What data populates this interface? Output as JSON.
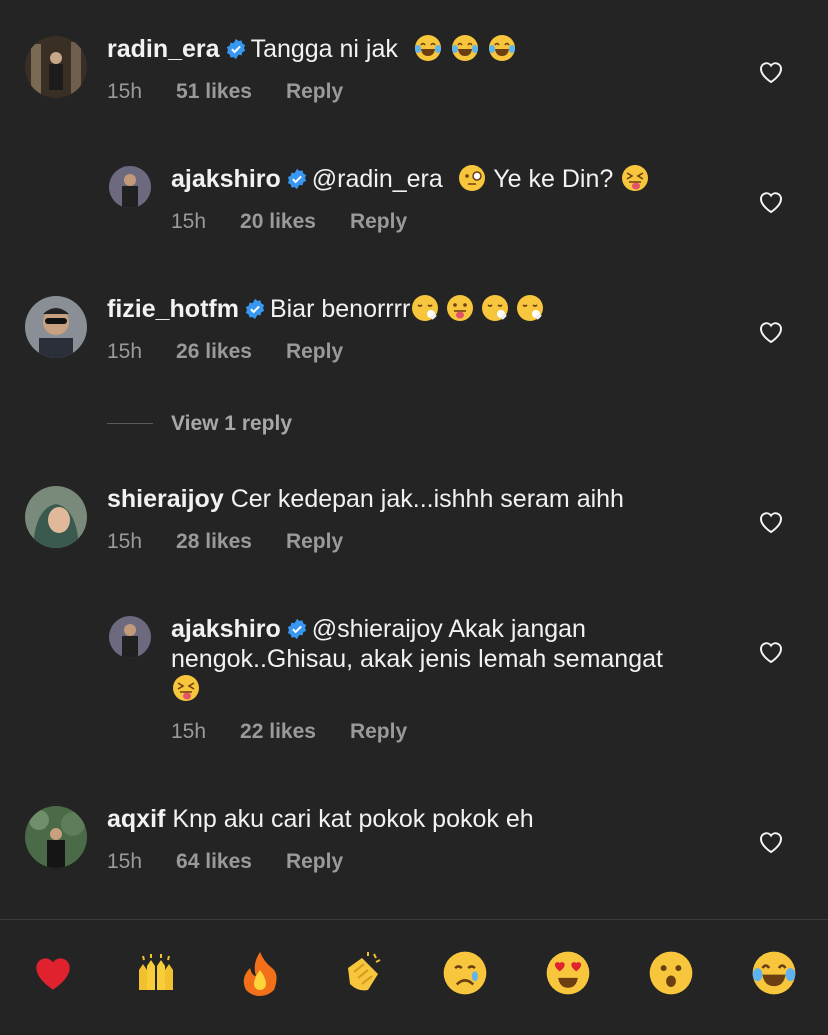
{
  "comments": [
    {
      "user": "radin_era",
      "verified": true,
      "text": "Tangga ni jak",
      "emojis": [
        "face-with-tears-of-joy",
        "face-with-tears-of-joy",
        "face-with-tears-of-joy"
      ],
      "time": "15h",
      "likes": "51 likes",
      "reply": "Reply"
    },
    {
      "user": "ajakshiro",
      "verified": true,
      "mention": "@radin_era",
      "text": "Ye ke Din?",
      "emojis_before": [
        "face-with-monocle"
      ],
      "emojis": [
        "squinting-face-with-tongue"
      ],
      "time": "15h",
      "likes": "20 likes",
      "reply": "Reply"
    },
    {
      "user": "fizie_hotfm",
      "verified": true,
      "text": "Biar benorrrr",
      "emojis": [
        "face-exhaling",
        "face-with-tongue",
        "face-exhaling",
        "face-exhaling"
      ],
      "time": "15h",
      "likes": "26 likes",
      "reply": "Reply"
    },
    {
      "user": "shieraijoy",
      "verified": false,
      "text": "Cer kedepan jak...ishhh seram aihh",
      "emojis": [],
      "time": "15h",
      "likes": "28 likes",
      "reply": "Reply"
    },
    {
      "user": "ajakshiro",
      "verified": true,
      "mention": "@shieraijoy",
      "text": "Akak jangan",
      "text2": "nengok..Ghisau, akak jenis lemah semangat",
      "emojis": [
        "squinting-face-with-tongue"
      ],
      "time": "15h",
      "likes": "22 likes",
      "reply": "Reply"
    },
    {
      "user": "aqxif",
      "verified": false,
      "text": "Knp aku cari kat pokok pokok eh",
      "emojis": [],
      "time": "15h",
      "likes": "64 likes",
      "reply": "Reply"
    }
  ],
  "view_replies": "View 1 reply",
  "reactions": [
    "red-heart",
    "raising-hands",
    "fire",
    "clapping-hands",
    "crying-face",
    "smiling-face-with-heart-eyes",
    "face-with-open-mouth",
    "face-with-tears-of-joy"
  ],
  "colors": {
    "background": "#242424",
    "text": "#f2f2f2",
    "muted": "#9a9a9a",
    "verified": "#3897f0"
  }
}
